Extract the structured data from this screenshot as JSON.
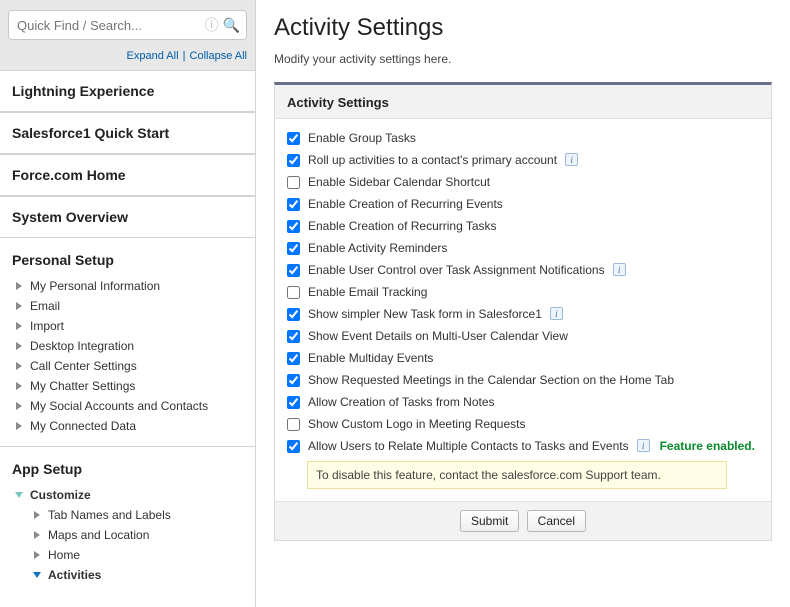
{
  "search": {
    "placeholder": "Quick Find / Search..."
  },
  "expand": {
    "expand": "Expand All",
    "collapse": "Collapse All"
  },
  "topNav": [
    "Lightning Experience",
    "Salesforce1 Quick Start",
    "Force.com Home",
    "System Overview"
  ],
  "personal": {
    "title": "Personal Setup",
    "items": [
      "My Personal Information",
      "Email",
      "Import",
      "Desktop Integration",
      "Call Center Settings",
      "My Chatter Settings",
      "My Social Accounts and Contacts",
      "My Connected Data"
    ]
  },
  "app": {
    "title": "App Setup",
    "customize": "Customize",
    "children": [
      "Tab Names and Labels",
      "Maps and Location",
      "Home",
      "Activities"
    ]
  },
  "page": {
    "title": "Activity Settings",
    "subtitle": "Modify your activity settings here.",
    "panel_title": "Activity Settings"
  },
  "options": [
    {
      "label": "Enable Group Tasks",
      "checked": true,
      "info": false
    },
    {
      "label": "Roll up activities to a contact's primary account",
      "checked": true,
      "info": true
    },
    {
      "label": "Enable Sidebar Calendar Shortcut",
      "checked": false,
      "info": false
    },
    {
      "label": "Enable Creation of Recurring Events",
      "checked": true,
      "info": false
    },
    {
      "label": "Enable Creation of Recurring Tasks",
      "checked": true,
      "info": false
    },
    {
      "label": "Enable Activity Reminders",
      "checked": true,
      "info": false
    },
    {
      "label": "Enable User Control over Task Assignment Notifications",
      "checked": true,
      "info": true
    },
    {
      "label": "Enable Email Tracking",
      "checked": false,
      "info": false
    },
    {
      "label": "Show simpler New Task form in Salesforce1",
      "checked": true,
      "info": true
    },
    {
      "label": "Show Event Details on Multi-User Calendar View",
      "checked": true,
      "info": false
    },
    {
      "label": "Enable Multiday Events",
      "checked": true,
      "info": false
    },
    {
      "label": "Show Requested Meetings in the Calendar Section on the Home Tab",
      "checked": true,
      "info": false
    },
    {
      "label": "Allow Creation of Tasks from Notes",
      "checked": true,
      "info": false
    },
    {
      "label": "Show Custom Logo in Meeting Requests",
      "checked": false,
      "info": false
    }
  ],
  "shared_contacts": {
    "label": "Allow Users to Relate Multiple Contacts to Tasks and Events",
    "checked": true,
    "info": true,
    "badge": "Feature enabled.",
    "note": "To disable this feature, contact the salesforce.com Support team."
  },
  "buttons": {
    "submit": "Submit",
    "cancel": "Cancel"
  }
}
